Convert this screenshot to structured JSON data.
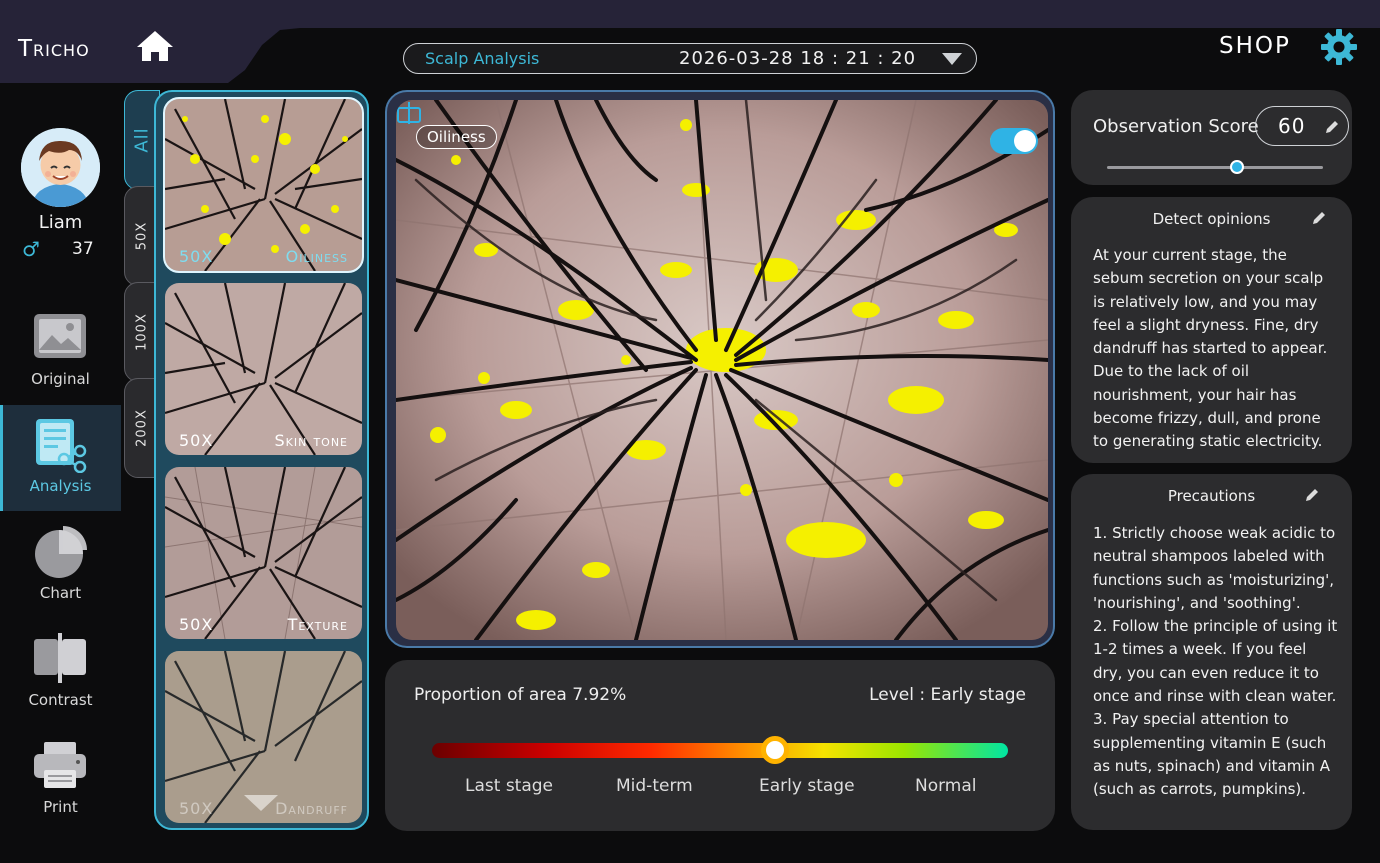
{
  "header": {
    "brand": "Tricho",
    "session_title": "Scalp Analysis",
    "datetime": "2026-03-28 18 : 21 : 20",
    "shop_label": "SHOP"
  },
  "user": {
    "name": "Liam",
    "gender_symbol": "♂",
    "age": "37"
  },
  "nav": [
    {
      "label": "Original",
      "icon": "image-icon",
      "active": false
    },
    {
      "label": "Analysis",
      "icon": "report-icon",
      "active": true
    },
    {
      "label": "Chart",
      "icon": "pie-chart-icon",
      "active": false
    },
    {
      "label": "Contrast",
      "icon": "compare-icon",
      "active": false
    },
    {
      "label": "Print",
      "icon": "printer-icon",
      "active": false
    }
  ],
  "magnification_tabs": [
    "All",
    "50X",
    "100X",
    "200X"
  ],
  "thumbnails": [
    {
      "mag": "50X",
      "type": "Oiliness"
    },
    {
      "mag": "50X",
      "type": "Skin tone"
    },
    {
      "mag": "50X",
      "type": "Texture"
    },
    {
      "mag": "50X",
      "type": "Dandruff"
    }
  ],
  "main_view": {
    "overlay_tag": "Oiliness",
    "overlay_enabled": true
  },
  "level": {
    "area_text": "Proportion of area 7.92%",
    "level_text": "Level : Early stage",
    "stages": [
      "Last stage",
      "Mid-term",
      "Early stage",
      "Normal"
    ],
    "indicator_fraction": 0.6
  },
  "observation": {
    "label": "Observation Score",
    "score": "60",
    "slider_fraction": 0.6
  },
  "detect_opinions": {
    "title": "Detect opinions",
    "text": "At your current stage, the sebum secretion on your scalp is relatively low, and you may feel a slight dryness. Fine, dry dandruff has started to appear. Due to the lack of oil nourishment, your hair has become frizzy, dull, and prone to generating static electricity."
  },
  "precautions": {
    "title": "Precautions",
    "items": [
      "1. Strictly choose weak acidic to neutral shampoos labeled with functions such as 'moisturizing', 'nourishing', and 'soothing'.",
      "2. Follow the principle of using it 1-2 times a week. If you feel dry, you can even reduce it to once and rinse with clean water.",
      "3. Pay special attention to supplementing vitamin E (such as nuts, spinach) and vitamin A (such as carrots, pumpkins)."
    ]
  },
  "colors": {
    "accent": "#3db8d6",
    "panel": "#2c2c2e",
    "oil_highlight": "#f5f000"
  }
}
